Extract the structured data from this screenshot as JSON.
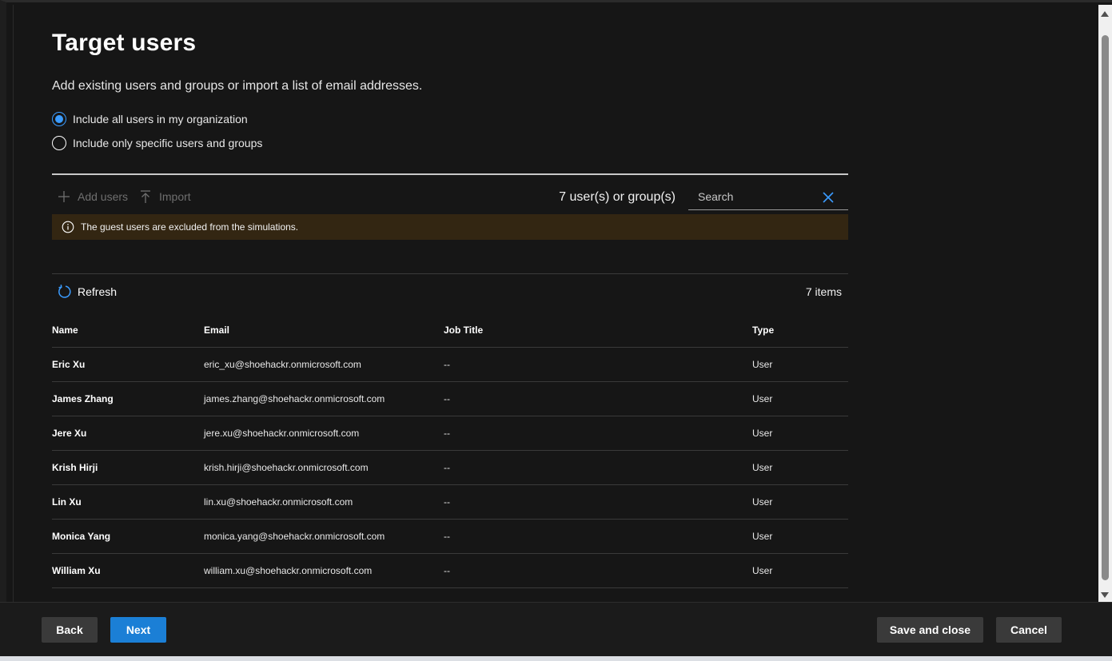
{
  "page": {
    "title": "Target users",
    "subtitle": "Add existing users and groups or import a list of email addresses."
  },
  "options": [
    {
      "label": "Include all users in my organization",
      "checked": true
    },
    {
      "label": "Include only specific users and groups",
      "checked": false
    }
  ],
  "toolbar": {
    "add_users_label": "Add users",
    "import_label": "Import",
    "count_text": "7 user(s) or group(s)",
    "search_placeholder": "Search"
  },
  "banner": {
    "text": "The guest users are excluded from the simulations."
  },
  "list": {
    "refresh_label": "Refresh",
    "items_count": "7 items",
    "columns": [
      "Name",
      "Email",
      "Job Title",
      "Type"
    ],
    "rows": [
      {
        "name": "Eric Xu",
        "email": "eric_xu@shoehackr.onmicrosoft.com",
        "job_title": "--",
        "type": "User"
      },
      {
        "name": "James Zhang",
        "email": "james.zhang@shoehackr.onmicrosoft.com",
        "job_title": "--",
        "type": "User"
      },
      {
        "name": "Jere Xu",
        "email": "jere.xu@shoehackr.onmicrosoft.com",
        "job_title": "--",
        "type": "User"
      },
      {
        "name": "Krish Hirji",
        "email": "krish.hirji@shoehackr.onmicrosoft.com",
        "job_title": "--",
        "type": "User"
      },
      {
        "name": "Lin Xu",
        "email": "lin.xu@shoehackr.onmicrosoft.com",
        "job_title": "--",
        "type": "User"
      },
      {
        "name": "Monica Yang",
        "email": "monica.yang@shoehackr.onmicrosoft.com",
        "job_title": "--",
        "type": "User"
      },
      {
        "name": "William Xu",
        "email": "william.xu@shoehackr.onmicrosoft.com",
        "job_title": "--",
        "type": "User"
      }
    ]
  },
  "footer": {
    "back_label": "Back",
    "next_label": "Next",
    "save_close_label": "Save and close",
    "cancel_label": "Cancel"
  },
  "colors": {
    "accent": "#1b7fd6",
    "banner_bg": "#332612",
    "background": "#161616"
  }
}
